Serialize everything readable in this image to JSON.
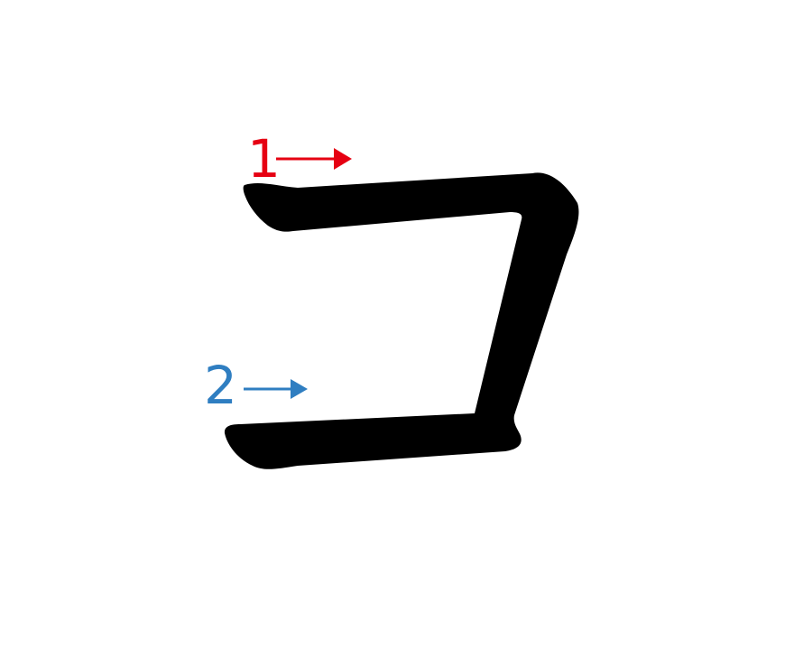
{
  "character": "コ",
  "strokes": [
    {
      "number": "1",
      "color": "#e60012",
      "direction": "right"
    },
    {
      "number": "2",
      "color": "#2f7ec1",
      "direction": "right"
    }
  ],
  "glyph_color": "#000000"
}
